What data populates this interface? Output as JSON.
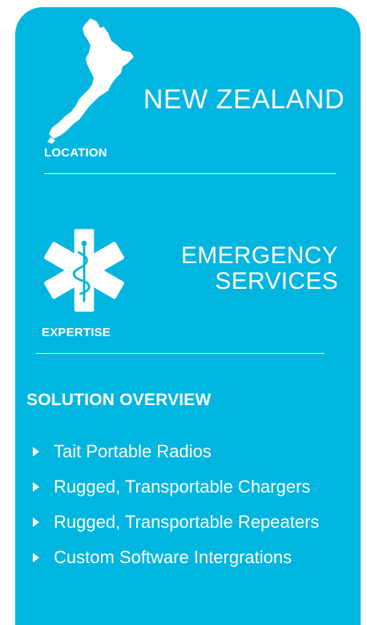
{
  "location": {
    "label": "LOCATION",
    "value": "NEW ZEALAND",
    "icon": "new-zealand-map-icon"
  },
  "expertise": {
    "label": "EXPERTISE",
    "value_line1": "EMERGENCY",
    "value_line2": "SERVICES",
    "icon": "star-of-life-icon"
  },
  "overview": {
    "heading": "SOLUTION OVERVIEW",
    "items": [
      "Tait Portable Radios",
      "Rugged, Transportable Chargers",
      "Rugged, Transportable Repeaters",
      "Custom Software Intergrations"
    ]
  },
  "colors": {
    "card_background": "#00b5e0",
    "text": "#ffffff"
  }
}
